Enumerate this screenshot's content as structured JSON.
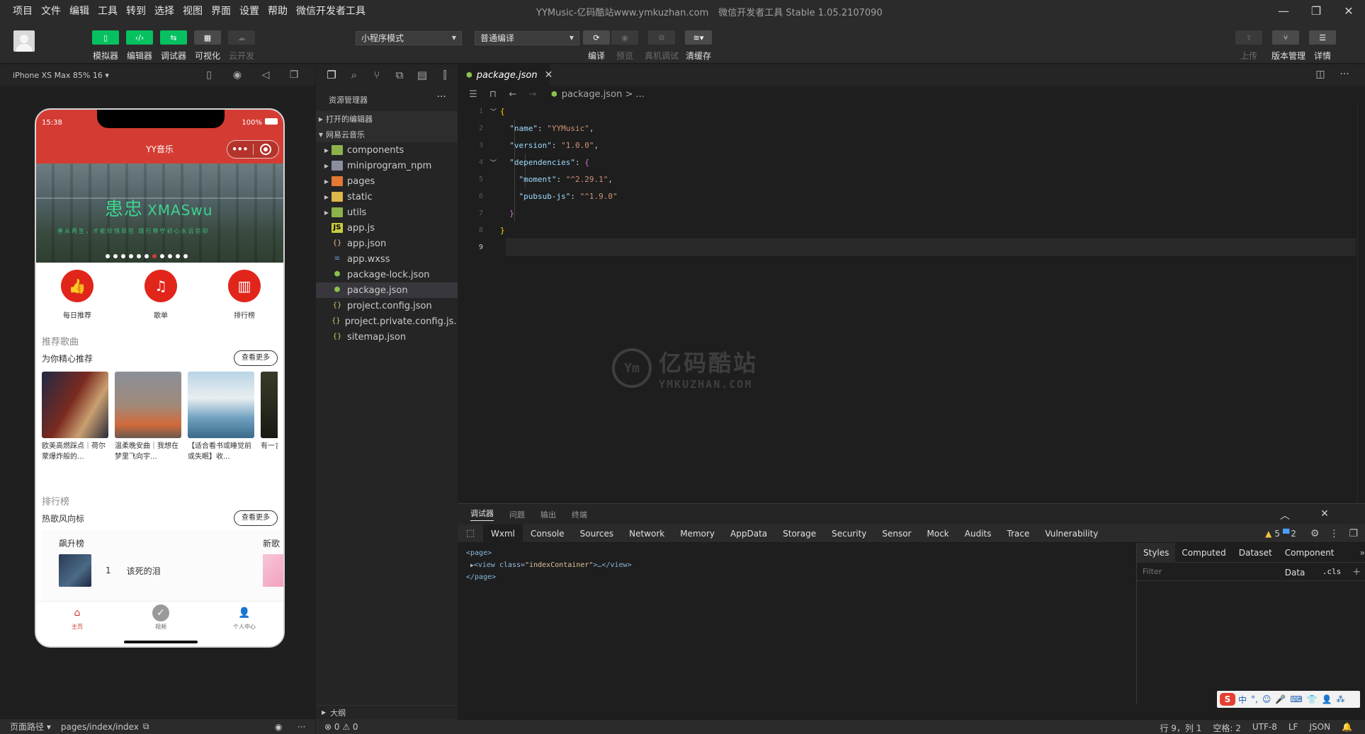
{
  "menu": [
    "项目",
    "文件",
    "编辑",
    "工具",
    "转到",
    "选择",
    "视图",
    "界面",
    "设置",
    "帮助",
    "微信开发者工具"
  ],
  "window": {
    "title": "YYMusic-亿码酷站www.ymkuzhan.com",
    "subtitle": "微信开发者工具 Stable 1.05.2107090"
  },
  "toolbar": {
    "simulator": "模拟器",
    "editor": "编辑器",
    "debugger": "调试器",
    "visual": "可视化",
    "cloud": "云开发",
    "mode_select": "小程序模式",
    "compile_select": "普通编译",
    "compile": "编译",
    "preview": "预览",
    "real_debug": "真机调试",
    "clear_cache": "清缓存",
    "upload": "上传",
    "version": "版本管理",
    "details": "详情"
  },
  "simulator": {
    "device": "iPhone XS Max 85% 16 ▾",
    "footer_path_label": "页面路径 ▾",
    "footer_path": "pages/index/index"
  },
  "phone": {
    "time": "15:38",
    "battery": "100%",
    "nav_title": "YY音乐",
    "banner_title": "患忠",
    "banner_title_en": "XMASwu",
    "banner_sub": "善从再生，才能珍惜现在 践行尊守初心永远信仰",
    "quick": [
      {
        "icon": "thumb-up-icon",
        "label": "每日推荐"
      },
      {
        "icon": "playlist-icon",
        "label": "歌单"
      },
      {
        "icon": "chart-icon",
        "label": "排行榜"
      }
    ],
    "recommend_title": "推荐歌曲",
    "recommend_sub": "为你精心推荐",
    "more": "查看更多",
    "cards": [
      {
        "text": "欧美高燃踩点｜荷尔蒙爆炸般的...",
        "color": "#6b3a2e"
      },
      {
        "text": "温柔晚安曲｜我想在梦里飞向宇...",
        "color": "#8a7a70"
      },
      {
        "text": "【适合看书或睡觉前或失眠】收...",
        "color": "#8fb3c8"
      },
      {
        "text": "有一言，",
        "color": "#2a2a20"
      }
    ],
    "rank_title": "排行榜",
    "rank_sub": "热歌风向标",
    "rank_name": "飙升榜",
    "rank_name2": "新歌",
    "rank_num": "1",
    "rank_song": "该死的泪",
    "tabs": [
      {
        "icon": "home-icon",
        "label": "主页"
      },
      {
        "icon": "video-icon",
        "label": "视频"
      },
      {
        "icon": "user-icon",
        "label": "个人中心"
      }
    ]
  },
  "explorer": {
    "title": "资源管理器",
    "open_editors": "打开的编辑器",
    "project": "网易云音乐",
    "items": [
      {
        "name": "components",
        "type": "folder",
        "color": "green"
      },
      {
        "name": "miniprogram_npm",
        "type": "folder",
        "color": "grey"
      },
      {
        "name": "pages",
        "type": "folder",
        "color": "orange"
      },
      {
        "name": "static",
        "type": "folder",
        "color": "yellow"
      },
      {
        "name": "utils",
        "type": "folder",
        "color": "green"
      },
      {
        "name": "app.js",
        "type": "js"
      },
      {
        "name": "app.json",
        "type": "json"
      },
      {
        "name": "app.wxss",
        "type": "css"
      },
      {
        "name": "package-lock.json",
        "type": "npm"
      },
      {
        "name": "package.json",
        "type": "npm"
      },
      {
        "name": "project.config.json",
        "type": "json"
      },
      {
        "name": "project.private.config.js...",
        "type": "json"
      },
      {
        "name": "sitemap.json",
        "type": "json"
      }
    ],
    "outline": "大纲",
    "footer": "⊗ 0 ⚠ 0"
  },
  "editor": {
    "tab": "package.json",
    "breadcrumb": "package.json > ...",
    "lines": [
      {
        "n": "1",
        "fold": "﹀"
      },
      {
        "n": "2"
      },
      {
        "n": "3"
      },
      {
        "n": "4",
        "fold": "﹀"
      },
      {
        "n": "5"
      },
      {
        "n": "6"
      },
      {
        "n": "7"
      },
      {
        "n": "8"
      },
      {
        "n": "9"
      }
    ],
    "code": {
      "name_key": "\"name\"",
      "name_val": "\"YYMusic\"",
      "version_key": "\"version\"",
      "version_val": "\"1.0.0\"",
      "deps_key": "\"dependencies\"",
      "moment_key": "\"moment\"",
      "moment_val": "\"^2.29.1\"",
      "pubsub_key": "\"pubsub-js\"",
      "pubsub_val": "\"^1.9.0\""
    }
  },
  "watermark": {
    "cn": "亿码酷站",
    "en": "YMKUZHAN.COM"
  },
  "panel": {
    "tabs": [
      "调试器",
      "问题",
      "输出",
      "终端"
    ],
    "devtools_tabs": [
      "Wxml",
      "Console",
      "Sources",
      "Network",
      "Memory",
      "AppData",
      "Storage",
      "Security",
      "Sensor",
      "Mock",
      "Audits",
      "Trace",
      "Vulnerability"
    ],
    "warn_count": "5",
    "info_count": "2",
    "wxml_open": "<page>",
    "wxml_view_tag": "<view ",
    "wxml_attr": "class=",
    "wxml_attr_val": "\"indexContainer\"",
    "wxml_view_close": ">…</view>",
    "wxml_close": "</page>",
    "styles_tabs": [
      "Styles",
      "Computed",
      "Dataset",
      "Component Data"
    ],
    "filter_placeholder": "Filter",
    "cls": ".cls"
  },
  "ime": {
    "logo": "S",
    "items": [
      "中",
      "°,",
      "☺",
      "🎤",
      "⌨",
      "👕",
      "👤",
      "⁂"
    ]
  },
  "status": {
    "position": "行 9，列 1",
    "spaces": "空格: 2",
    "encoding": "UTF-8",
    "eol": "LF",
    "lang": "JSON",
    "bell": "🔔"
  }
}
